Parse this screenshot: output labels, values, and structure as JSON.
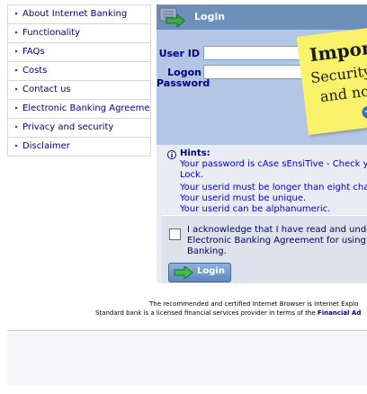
{
  "nav": {
    "items": [
      {
        "label": "About Internet Banking"
      },
      {
        "label": "Functionality"
      },
      {
        "label": "FAQs"
      },
      {
        "label": "Costs"
      },
      {
        "label": "Contact us"
      },
      {
        "label": "Electronic Banking Agreement"
      },
      {
        "label": "Privacy and security"
      },
      {
        "label": "Disclaimer"
      }
    ]
  },
  "login": {
    "title": "Login",
    "user_id_label": "User ID",
    "password_label_line1": "Logon",
    "password_label_line2": "Password",
    "user_id_value": "",
    "password_value": ""
  },
  "sticky": {
    "line1": "Import",
    "line2": "Security",
    "line3": "and not"
  },
  "hints": {
    "title": "Hints:",
    "items": [
      "Your password is cAse sEnsiTive - Check your",
      "Lock.",
      "Your userid must be longer than eight charact",
      "Your userid must be unique.",
      "Your userid can be alphanumeric."
    ]
  },
  "acknowledge": {
    "line1": "I acknowledge that I have read and understa",
    "line2": "Electronic Banking Agreement for using Inte",
    "line3": "Banking.",
    "checked": false
  },
  "login_button": {
    "label": "Login"
  },
  "footer": {
    "line1": "The recommended and certified Internet Browser is Internet Explo",
    "line2_text": "Standard bank is a licensed financial services provider in terms of the",
    "line2_link": "Financial Ad"
  },
  "icons": {
    "bullet": "caret-right-icon",
    "header": "login-arrow-icon",
    "hints": "info-icon",
    "button": "green-arrow-icon"
  },
  "colors": {
    "header_bar": "#6d8fb9",
    "form_area": "#b4c6e5",
    "sticky_note": "#fbf26c",
    "text_navy": "#000080"
  }
}
